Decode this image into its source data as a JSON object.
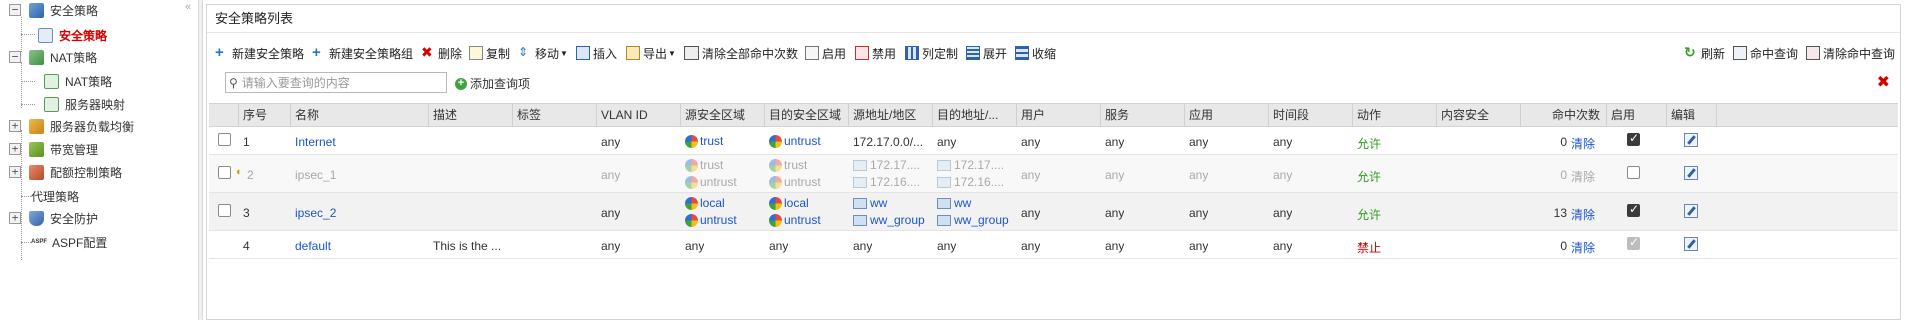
{
  "nav": {
    "items": [
      {
        "label": "安全策略",
        "icon": "shield-policy-icon",
        "toggle": "−"
      },
      {
        "label": "安全策略",
        "icon": "policy-doc-icon",
        "selected": true
      },
      {
        "label": "NAT策略",
        "icon": "nat-icon",
        "toggle": "−"
      },
      {
        "label": "NAT策略",
        "icon": "nat-doc-icon"
      },
      {
        "label": "服务器映射",
        "icon": "server-map-icon"
      },
      {
        "label": "服务器负载均衡",
        "icon": "load-balance-icon",
        "toggle": "+"
      },
      {
        "label": "带宽管理",
        "icon": "bandwidth-icon",
        "toggle": "+"
      },
      {
        "label": "配额控制策略",
        "icon": "quota-icon",
        "toggle": "+"
      },
      {
        "label": "代理策略",
        "icon": "proxy-icon"
      },
      {
        "label": "安全防护",
        "icon": "shield-icon",
        "toggle": "+"
      },
      {
        "label": "ASPF配置",
        "icon": "aspf-icon",
        "icon_text": "ASPF"
      }
    ],
    "collapse_glyph": "«"
  },
  "panel": {
    "title": "安全策略列表"
  },
  "toolbar": {
    "new_policy": "新建安全策略",
    "new_group": "新建安全策略组",
    "delete": "删除",
    "copy": "复制",
    "move": "移动",
    "insert": "插入",
    "export": "导出",
    "clear_all_hits": "清除全部命中次数",
    "enable": "启用",
    "disable": "禁用",
    "customize_columns": "列定制",
    "expand": "展开",
    "collapse": "收缩",
    "refresh": "刷新",
    "hit_query": "命中查询",
    "clear_hit_query": "清除命中查询"
  },
  "search": {
    "placeholder": "请输入要查询的内容",
    "add_query": "添加查询项"
  },
  "table": {
    "headers": [
      "序号",
      "名称",
      "描述",
      "标签",
      "VLAN ID",
      "源安全区域",
      "目的安全区域",
      "源地址/地区",
      "目的地址/...",
      "用户",
      "服务",
      "应用",
      "时间段",
      "动作",
      "内容安全",
      "命中次数",
      "启用",
      "编辑"
    ],
    "clear_label": "清除",
    "rows": [
      {
        "no": "1",
        "name": "Internet",
        "desc": "",
        "vlan": "any",
        "src_zone": [
          "trust"
        ],
        "dst_zone": [
          "untrust"
        ],
        "src_addr": [
          "172.17.0.0/..."
        ],
        "dst_addr": [
          "any"
        ],
        "user": "any",
        "service": "any",
        "app": "any",
        "time": "any",
        "action": "允许",
        "hits": "0",
        "enabled": true,
        "disabled_row": false
      },
      {
        "no": "2",
        "name": "ipsec_1",
        "desc": "",
        "vlan": "any",
        "src_zone": [
          "trust",
          "untrust"
        ],
        "dst_zone": [
          "trust",
          "untrust"
        ],
        "src_addr": [
          "172.17....",
          "172.16...."
        ],
        "dst_addr": [
          "172.17....",
          "172.16...."
        ],
        "user": "any",
        "service": "any",
        "app": "any",
        "time": "any",
        "action": "允许",
        "hits": "0",
        "enabled": false,
        "disabled_row": true
      },
      {
        "no": "3",
        "name": "ipsec_2",
        "desc": "",
        "vlan": "any",
        "src_zone": [
          "local",
          "untrust"
        ],
        "dst_zone": [
          "local",
          "untrust"
        ],
        "src_addr": [
          "ww",
          "ww_group"
        ],
        "dst_addr": [
          "ww",
          "ww_group"
        ],
        "user": "any",
        "service": "any",
        "app": "any",
        "time": "any",
        "action": "允许",
        "hits": "13",
        "enabled": true,
        "disabled_row": false
      },
      {
        "no": "4",
        "name": "default",
        "desc": "This is the ...",
        "vlan": "any",
        "src_zone": [
          "any"
        ],
        "dst_zone": [
          "any"
        ],
        "src_addr": [
          "any"
        ],
        "dst_addr": [
          "any"
        ],
        "user": "any",
        "service": "any",
        "app": "any",
        "time": "any",
        "action": "禁止",
        "hits": "0",
        "enabled": true,
        "disabled_row": false,
        "enable_locked": true
      }
    ]
  },
  "colors": {
    "selected_nav": "#d30000",
    "link": "#1a56c8",
    "permit": "#2f9e1f",
    "deny": "#c80000",
    "header_bg": "#e8e8e8"
  }
}
